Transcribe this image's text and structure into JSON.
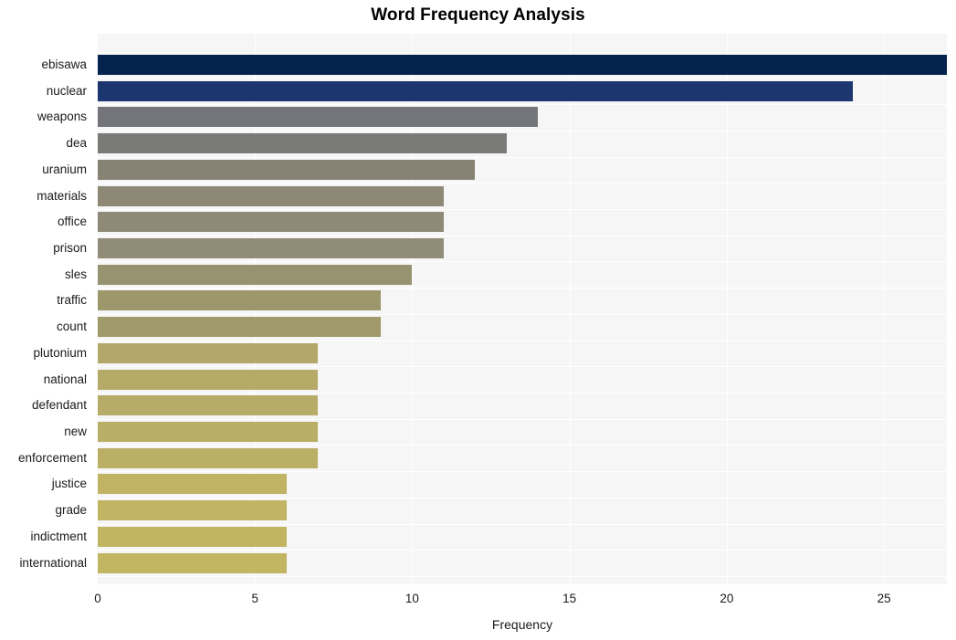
{
  "chart_data": {
    "type": "bar",
    "orientation": "horizontal",
    "title": "Word Frequency Analysis",
    "xlabel": "Frequency",
    "ylabel": "",
    "xlim": [
      0,
      27
    ],
    "ylim": null,
    "grid": true,
    "legend": null,
    "x_ticks": [
      0,
      5,
      10,
      15,
      20,
      25
    ],
    "x_tick_labels": [
      "0",
      "5",
      "10",
      "15",
      "20",
      "25"
    ],
    "categories": [
      "ebisawa",
      "nuclear",
      "weapons",
      "dea",
      "uranium",
      "materials",
      "office",
      "prison",
      "sles",
      "traffic",
      "count",
      "plutonium",
      "national",
      "defendant",
      "new",
      "enforcement",
      "justice",
      "grade",
      "indictment",
      "international"
    ],
    "values": [
      27,
      24,
      14,
      13,
      12,
      11,
      11,
      11,
      10,
      9,
      9,
      7,
      7,
      7,
      7,
      7,
      6,
      6,
      6,
      6
    ],
    "bar_colors": [
      "#04244d",
      "#1c3670",
      "#74757a",
      "#7a7a78",
      "#868274",
      "#8d8976",
      "#8e8a77",
      "#908c78",
      "#979270",
      "#9d976c",
      "#a09a6b",
      "#b3a869",
      "#b5aa68",
      "#b7ac67",
      "#b9ae66",
      "#bbaf65",
      "#c0b363",
      "#c1b463",
      "#c2b562",
      "#c3b662"
    ],
    "plot_background": "#f6f6f7",
    "gridline_color": "#ffffff",
    "figure_background": "#ffffff",
    "text_color": "#1a1a1a",
    "title_color": "#000000"
  }
}
